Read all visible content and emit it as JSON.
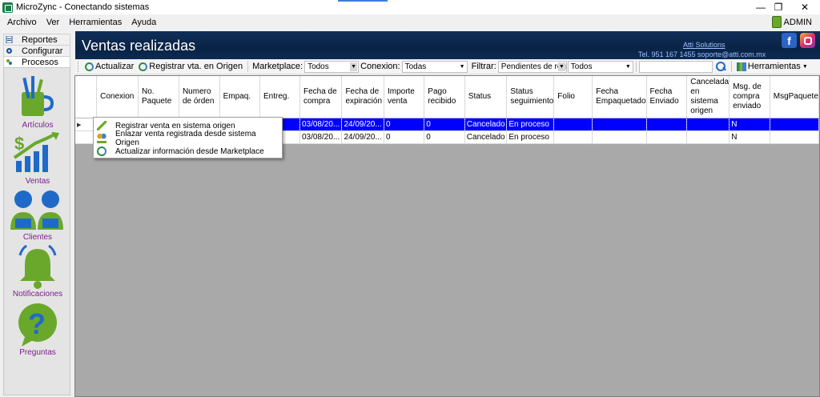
{
  "window": {
    "title": "MicroZync - Conectando sistemas",
    "controls": [
      "—",
      "❐",
      "✕"
    ]
  },
  "menu": {
    "items": [
      "Archivo",
      "Ver",
      "Herramientas",
      "Ayuda"
    ],
    "user": "ADMIN"
  },
  "left_tabs": [
    "Reportes",
    "Configurar",
    "Procesos"
  ],
  "nav": {
    "items": [
      {
        "label": "Artículos",
        "icon": "articles-icon"
      },
      {
        "label": "Ventas",
        "icon": "sales-chart-icon"
      },
      {
        "label": "Clientes",
        "icon": "customers-icon"
      },
      {
        "label": "Notificaciones",
        "icon": "bell-icon"
      },
      {
        "label": "Preguntas",
        "icon": "question-icon"
      }
    ]
  },
  "header": {
    "title": "Ventas realizadas",
    "company": "Atti Solutions",
    "contact": "Tel. 951 167 1455  soporte@atti.com.mx"
  },
  "toolbar": {
    "refresh": "Actualizar",
    "register_origin": "Registrar vta. en Origen",
    "marketplace_label": "Marketplace:",
    "marketplace_value": "Todos",
    "conexion_label": "Conexion:",
    "conexion_value": "Todas",
    "filter_label": "Filtrar:",
    "filter_value": "Pendientes de reg",
    "filter2_value": "Todos",
    "search_value": "",
    "tools": "Herramientas"
  },
  "grid": {
    "columns": [
      "Conexion",
      "No. Paquete",
      "Numero de órden",
      "Empaq.",
      "Entreg.",
      "Fecha de compra",
      "Fecha de expiración",
      "Importe venta",
      "Pago recibido",
      "Status",
      "Status seguimiento",
      "Folio",
      "Fecha Empaquetado",
      "Fecha Enviado",
      "Cancelada en sistema origen",
      "Msg. de compra enviado",
      "MsgPaquete"
    ],
    "rows": [
      {
        "fecha_compra": "03/08/20...",
        "fecha_exp": "24/09/20...",
        "importe": "0",
        "pago": "0",
        "status": "Cancelado",
        "seguimiento": "En proceso",
        "msg": "N"
      },
      {
        "fecha_compra": "03/08/20...",
        "fecha_exp": "24/09/20...",
        "importe": "0",
        "pago": "0",
        "status": "Cancelado",
        "seguimiento": "En proceso",
        "msg": "N"
      }
    ]
  },
  "context_menu": {
    "items": [
      {
        "label": "Registrar venta en sistema origen",
        "icon": "pencil-icon"
      },
      {
        "label": "Enlazar venta registrada desde sistema Origen",
        "icon": "link-users-icon"
      },
      {
        "label": "Actualizar información desde Marketplace",
        "icon": "sync-icon"
      }
    ]
  },
  "colors": {
    "header_bg": "#0a2346",
    "selection": "#0000ff",
    "nav_label": "#7a1f8e",
    "icon_green": "#6aa82c",
    "icon_blue": "#1f6ac9"
  }
}
